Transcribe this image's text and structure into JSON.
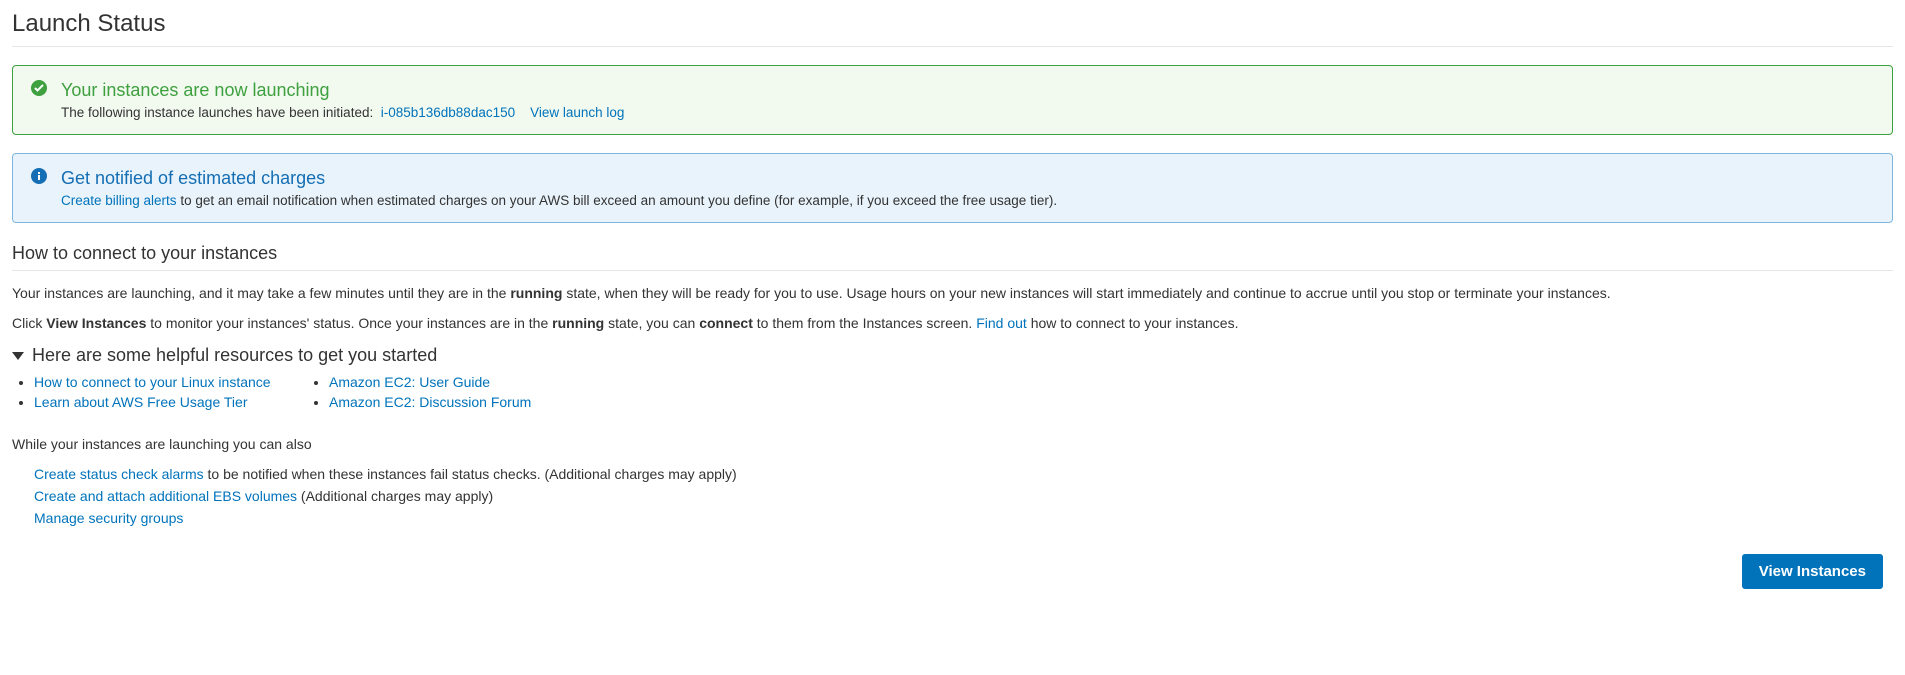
{
  "pageTitle": "Launch Status",
  "successAlert": {
    "title": "Your instances are now launching",
    "preText": "The following instance launches have been initiated:",
    "instanceId": "i-085b136db88dac150",
    "viewLogLink": "View launch log"
  },
  "infoAlert": {
    "title": "Get notified of estimated charges",
    "link": "Create billing alerts",
    "text": "to get an email notification when estimated charges on your AWS bill exceed an amount you define (for example, if you exceed the free usage tier)."
  },
  "howToConnect": {
    "heading": "How to connect to your instances",
    "para1_a": "Your instances are launching, and it may take a few minutes until they are in the ",
    "para1_b": "running",
    "para1_c": " state, when they will be ready for you to use. Usage hours on your new instances will start immediately and continue to accrue until you stop or terminate your instances.",
    "para2_a": "Click ",
    "para2_b": "View Instances",
    "para2_c": " to monitor your instances' status. Once your instances are in the ",
    "para2_d": "running",
    "para2_e": " state, you can ",
    "para2_f": "connect",
    "para2_g": " to them from the Instances screen. ",
    "para2_link": "Find out",
    "para2_h": " how to connect to your instances."
  },
  "resources": {
    "heading": "Here are some helpful resources to get you started",
    "col1": [
      "How to connect to your Linux instance",
      "Learn about AWS Free Usage Tier"
    ],
    "col2": [
      "Amazon EC2: User Guide",
      "Amazon EC2: Discussion Forum"
    ]
  },
  "alsoSection": {
    "intro": "While your instances are launching you can also",
    "items": [
      {
        "link": "Create status check alarms",
        "text": " to be notified when these instances fail status checks. (Additional charges may apply)"
      },
      {
        "link": "Create and attach additional EBS volumes",
        "text": " (Additional charges may apply)"
      },
      {
        "link": "Manage security groups",
        "text": ""
      }
    ]
  },
  "viewInstancesButton": "View Instances"
}
